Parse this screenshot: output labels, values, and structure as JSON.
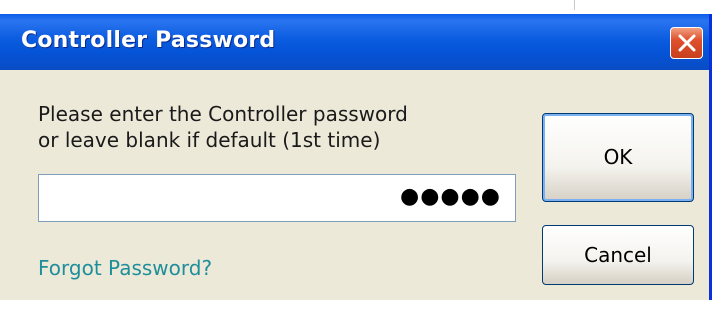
{
  "dialog": {
    "title": "Controller Password",
    "prompt_line1": "Please enter the Controller password",
    "prompt_line2": "or leave blank if default (1st time)",
    "password_value": "●●●●●",
    "forgot_link": "Forgot Password?",
    "ok_label": "OK",
    "cancel_label": "Cancel"
  },
  "icons": {
    "close": "close-icon"
  },
  "colors": {
    "titlebar": "#0553d6",
    "close_button": "#e0502c",
    "window_background": "#ece9d8",
    "link": "#1e8f9a",
    "button_border": "#003c74",
    "input_border": "#7f9db9"
  }
}
